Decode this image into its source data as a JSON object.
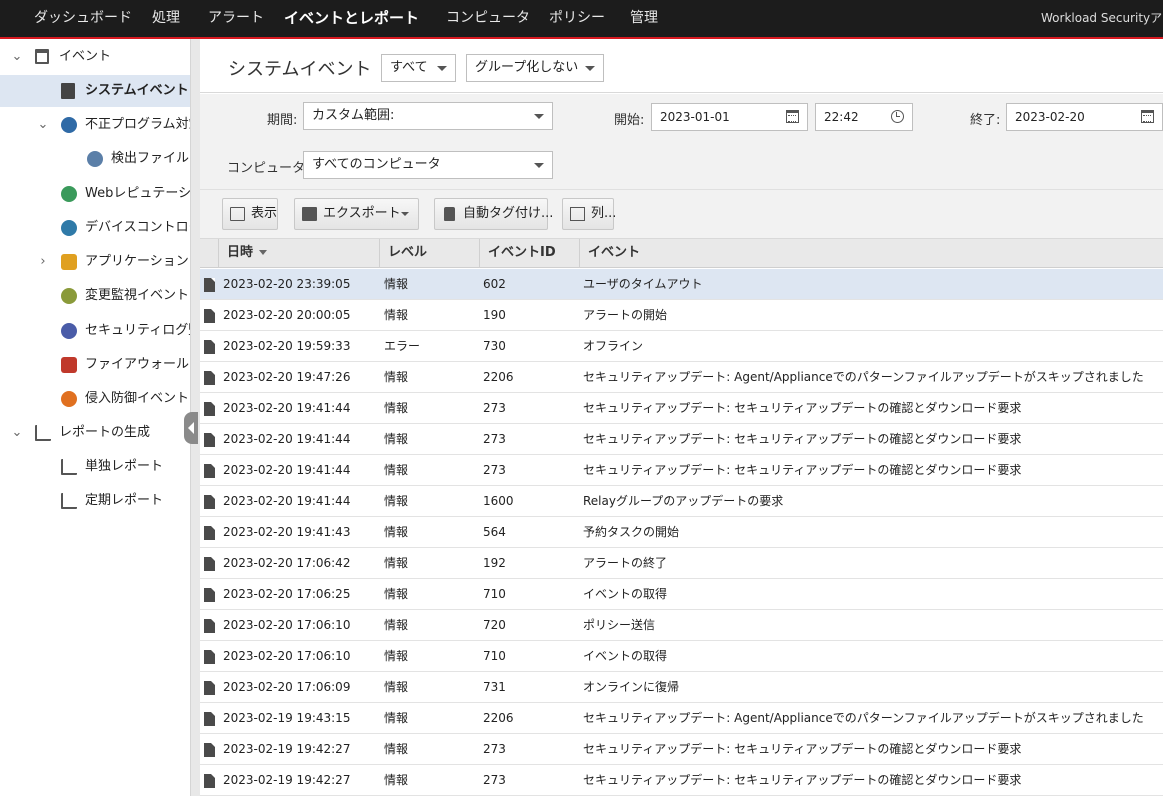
{
  "topnav": {
    "items": [
      "ダッシュボード",
      "処理",
      "アラート",
      "イベントとレポート",
      "コンピュータ",
      "ポリシー",
      "管理"
    ],
    "active": "イベントとレポート",
    "account": "Workload Securityアカ"
  },
  "sidebar": {
    "events_label": "イベント",
    "system_events": "システムイベント",
    "anti_malware": "不正プログラム対策",
    "detected_files": "検出ファイル",
    "web_reputation": "Webレピュテーション",
    "device_control": "デバイスコントロール",
    "app_control": "アプリケーションコントロール",
    "integrity_monitoring": "変更監視イベント",
    "log_inspection": "セキュリティログ監視",
    "firewall": "ファイアウォールイベント",
    "intrusion_prevention": "侵入防御イベント",
    "reports_label": "レポートの生成",
    "single_report": "単独レポート",
    "scheduled_report": "定期レポート"
  },
  "header": {
    "title": "システムイベント",
    "filter_all": "すべて",
    "grouping": "グループ化しない"
  },
  "filters": {
    "period_label": "期間:",
    "period_value": "カスタム範囲:",
    "start_label": "開始:",
    "start_date": "2023-01-01",
    "start_time": "22:42",
    "end_label": "終了:",
    "end_date": "2023-02-20",
    "computer_label": "コンピュータ:",
    "computer_value": "すべてのコンピュータ"
  },
  "toolbar": {
    "view": "表示",
    "export": "エクスポート",
    "auto_tag": "自動タグ付け...",
    "columns": "列..."
  },
  "table": {
    "columns": [
      "日時",
      "レベル",
      "イベントID",
      "イベント"
    ],
    "rows": [
      [
        "2023-02-20 23:39:05",
        "情報",
        "602",
        "ユーザのタイムアウト"
      ],
      [
        "2023-02-20 20:00:05",
        "情報",
        "190",
        "アラートの開始"
      ],
      [
        "2023-02-20 19:59:33",
        "エラー",
        "730",
        "オフライン"
      ],
      [
        "2023-02-20 19:47:26",
        "情報",
        "2206",
        "セキュリティアップデート: Agent/Applianceでのパターンファイルアップデートがスキップされました"
      ],
      [
        "2023-02-20 19:41:44",
        "情報",
        "273",
        "セキュリティアップデート: セキュリティアップデートの確認とダウンロード要求"
      ],
      [
        "2023-02-20 19:41:44",
        "情報",
        "273",
        "セキュリティアップデート: セキュリティアップデートの確認とダウンロード要求"
      ],
      [
        "2023-02-20 19:41:44",
        "情報",
        "273",
        "セキュリティアップデート: セキュリティアップデートの確認とダウンロード要求"
      ],
      [
        "2023-02-20 19:41:44",
        "情報",
        "1600",
        "Relayグループのアップデートの要求"
      ],
      [
        "2023-02-20 19:41:43",
        "情報",
        "564",
        "予約タスクの開始"
      ],
      [
        "2023-02-20 17:06:42",
        "情報",
        "192",
        "アラートの終了"
      ],
      [
        "2023-02-20 17:06:25",
        "情報",
        "710",
        "イベントの取得"
      ],
      [
        "2023-02-20 17:06:10",
        "情報",
        "720",
        "ポリシー送信"
      ],
      [
        "2023-02-20 17:06:10",
        "情報",
        "710",
        "イベントの取得"
      ],
      [
        "2023-02-20 17:06:09",
        "情報",
        "731",
        "オンラインに復帰"
      ],
      [
        "2023-02-19 19:43:15",
        "情報",
        "2206",
        "セキュリティアップデート: Agent/Applianceでのパターンファイルアップデートがスキップされました"
      ],
      [
        "2023-02-19 19:42:27",
        "情報",
        "273",
        "セキュリティアップデート: セキュリティアップデートの確認とダウンロード要求"
      ],
      [
        "2023-02-19 19:42:27",
        "情報",
        "273",
        "セキュリティアップデート: セキュリティアップデートの確認とダウンロード要求"
      ]
    ]
  },
  "colors": {
    "topbar_bg": "#1c1c1c",
    "accent_red": "#d71920",
    "selected_bg": "#dde6f2"
  }
}
